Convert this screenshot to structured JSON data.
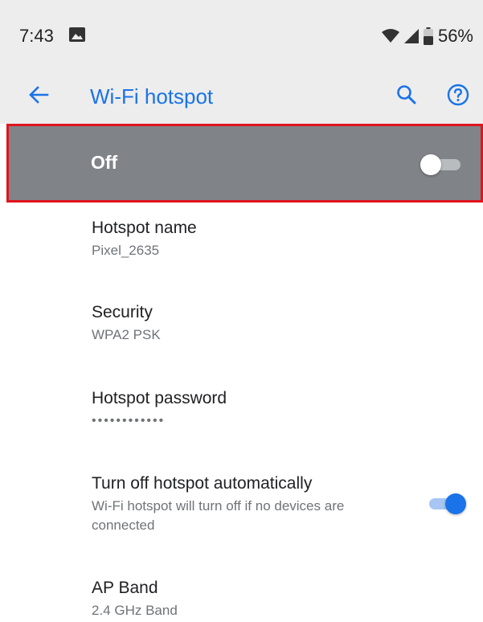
{
  "status_bar": {
    "time": "7:43",
    "image_icon": "image-icon",
    "wifi_icon": "wifi-icon",
    "signal_icon": "cell-signal-icon",
    "battery_icon": "battery-icon",
    "battery_percent": "56%"
  },
  "app_bar": {
    "back_icon": "arrow-back-icon",
    "title": "Wi-Fi hotspot",
    "search_icon": "search-icon",
    "help_icon": "help-icon"
  },
  "master_switch": {
    "label": "Off",
    "checked": false
  },
  "preferences": [
    {
      "title": "Hotspot name",
      "summary": "Pixel_2635"
    },
    {
      "title": "Security",
      "summary": "WPA2 PSK"
    },
    {
      "title": "Hotspot password",
      "summary": "••••••••••••"
    },
    {
      "title": "Turn off hotspot automatically",
      "summary": "Wi-Fi hotspot will turn off if no devices are connected",
      "checked": true
    },
    {
      "title": "AP Band",
      "summary": "2.4 GHz Band"
    }
  ],
  "colors": {
    "accent": "#1a73e8",
    "master_switch_bg": "#808488",
    "highlight_border": "#e0141e",
    "app_bar_bg": "#ededed"
  }
}
